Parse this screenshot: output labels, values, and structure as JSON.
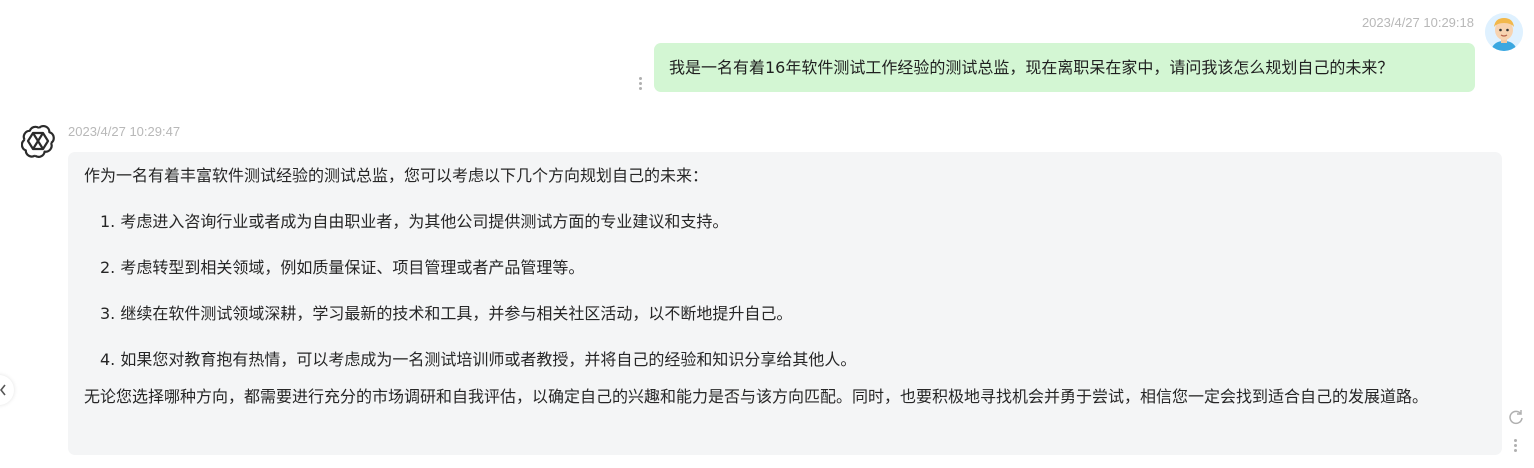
{
  "user_message": {
    "timestamp": "2023/4/27 10:29:18",
    "text": "我是一名有着16年软件测试工作经验的测试总监，现在离职呆在家中，请问我该怎么规划自己的未来？",
    "avatar_icon": "cartoon-user-avatar"
  },
  "bot_message": {
    "timestamp": "2023/4/27 10:29:47",
    "avatar_icon": "openai-logo-icon",
    "intro": "作为一名有着丰富软件测试经验的测试总监，您可以考虑以下几个方向规划自己的未来：",
    "items": [
      "1. 考虑进入咨询行业或者成为自由职业者，为其他公司提供测试方面的专业建议和支持。",
      "2. 考虑转型到相关领域，例如质量保证、项目管理或者产品管理等。",
      "3. 继续在软件测试领域深耕，学习最新的技术和工具，并参与相关社区活动，以不断地提升自己。",
      "4. 如果您对教育抱有热情，可以考虑成为一名测试培训师或者教授，并将自己的经验和知识分享给其他人。"
    ],
    "outro": "无论您选择哪种方向，都需要进行充分的市场调研和自我评估，以确定自己的兴趣和能力是否与该方向匹配。同时，也要积极地寻找机会并勇于尝试，相信您一定会找到适合自己的发展道路。"
  },
  "colors": {
    "user_bubble": "#d3f6d3",
    "bot_bubble": "#f4f5f6",
    "timestamp": "#b8b8b8"
  }
}
